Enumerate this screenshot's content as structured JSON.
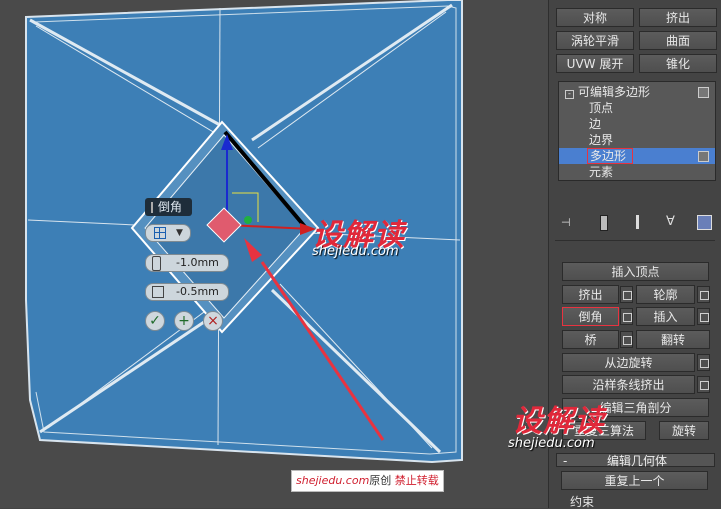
{
  "panel": {
    "top_buttons": [
      {
        "label": "对称"
      },
      {
        "label": "挤出"
      },
      {
        "label": "涡轮平滑"
      },
      {
        "label": "曲面"
      },
      {
        "label": "UVW 展开"
      },
      {
        "label": "锥化"
      }
    ],
    "stack": {
      "root": "可编辑多边形",
      "items": [
        "顶点",
        "边",
        "边界",
        "多边形",
        "元素"
      ],
      "selected": "多边形"
    },
    "edit_polygons": {
      "insert_vertex": "插入顶点",
      "extrude": "挤出",
      "outline": "轮廓",
      "bevel": "倒角",
      "inset": "插入",
      "bridge": "桥",
      "flip": "翻转",
      "hinge_from_edge": "从边旋转",
      "extrude_along_spline": "沿样条线挤出",
      "edit_triangulation": "编辑三角剖分",
      "retriangulate": "重复三算法",
      "turn": "旋转"
    },
    "edit_geometry": {
      "header": "编辑几何体",
      "header_sign": "-",
      "repeat_last": "重复上一个",
      "constraints": "约束"
    }
  },
  "caddy": {
    "title": "倒角",
    "height": "-1.0mm",
    "outline": "-0.5mm",
    "ok": "✓",
    "apply": "+",
    "cancel": "×"
  },
  "watermarks": {
    "logo": "设解读",
    "url": "shejiedu.com",
    "footer_site": "shejiedu.com",
    "footer_orig": "原创",
    "footer_ban": "禁止转载"
  },
  "colors": {
    "mesh": "#3b7db5",
    "highlight": "#e04050",
    "selection": "#4a7fd0"
  }
}
